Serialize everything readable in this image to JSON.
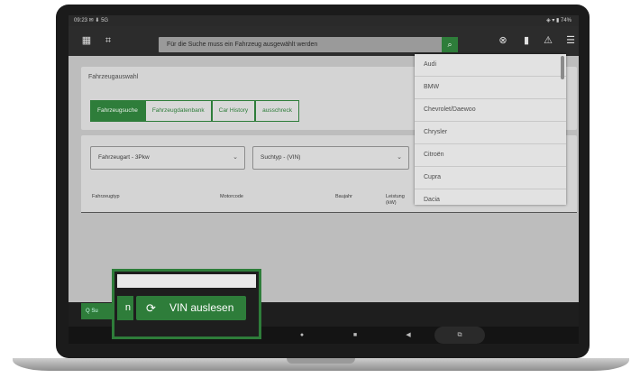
{
  "status_bar": {
    "left": "09:23 ✉ ⬇ 5G",
    "right": "◈ ▾ ▮ 74%"
  },
  "app_bar": {
    "grid_icon": "▦",
    "scan_icon": "⌗",
    "search_placeholder": "Für die Suche muss ein Fahrzeug ausgewählt werden",
    "search_icon": "⌕",
    "globe_icon": "⊗",
    "battery_icon": "▮",
    "warning_icon": "⚠",
    "menu_icon": "☰"
  },
  "vehicle_selection": {
    "title": "Fahrzeugauswahl",
    "tabs": [
      "Fahrzeugsuche",
      "Fahrzeugdatenbank",
      "Car History",
      "ausschreck"
    ],
    "active_tab": 0
  },
  "filters": {
    "vehicle_type": "Fahrzeugart - 3Pkw",
    "search_type": "Suchtyp - (VIN)",
    "chevron": "⌄"
  },
  "table": {
    "headers": [
      "Fahrzeugtyp",
      "Motorcode",
      "Baujahr",
      "Leistung (kW)"
    ]
  },
  "dropdown": {
    "items": [
      "Audi",
      "BMW",
      "Chevrolet/Daewoo",
      "Chrysler",
      "Citroën",
      "Cupra",
      "Dacia"
    ]
  },
  "bottom_bar": {
    "search_label": "Q  Su"
  },
  "nav": {
    "back": "●",
    "home": "■",
    "recents": "◀",
    "pill": "⧉"
  },
  "highlight": {
    "partial_text": "n",
    "vin_icon": "⟳",
    "vin_label": "VIN auslesen"
  },
  "colors": {
    "accent": "#2e7d3a",
    "screen_bg": "#bdbdbd",
    "bezel": "#1b1b1b"
  }
}
